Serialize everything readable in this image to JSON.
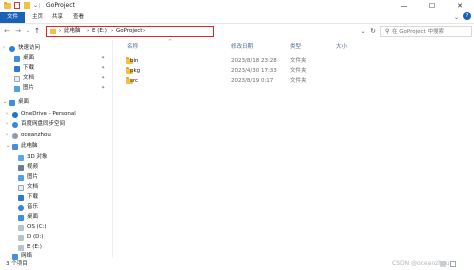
{
  "titlebar": {
    "title": "GoProject",
    "minimize": "—",
    "maximize": "☐",
    "close": "✕"
  },
  "ribbon": {
    "tabs": [
      "文件",
      "主页",
      "共享",
      "查看"
    ]
  },
  "address": {
    "segments": [
      "此电脑",
      "E (E:)",
      "GoProject"
    ],
    "sep": "›"
  },
  "search": {
    "placeholder": "在 GoProject 中搜索"
  },
  "nav": {
    "quick_access": "快速访问",
    "items": [
      {
        "label": "桌面",
        "icon": "desktop-icon",
        "pinned": true
      },
      {
        "label": "下载",
        "icon": "download-icon",
        "pinned": true
      },
      {
        "label": "文档",
        "icon": "document-icon",
        "pinned": true
      },
      {
        "label": "图片",
        "icon": "picture-icon",
        "pinned": true
      }
    ],
    "desktop": "桌面",
    "onedrive": "OneDrive - Personal",
    "baidu": "百度网盘同步空间",
    "user": "oceanzhou",
    "this_pc": "此电脑",
    "pc_items": [
      {
        "label": "3D 对象",
        "icon": "3d-objects-icon"
      },
      {
        "label": "视频",
        "icon": "video-icon"
      },
      {
        "label": "图片",
        "icon": "picture-icon"
      },
      {
        "label": "文档",
        "icon": "document-icon"
      },
      {
        "label": "下载",
        "icon": "download-icon"
      },
      {
        "label": "音乐",
        "icon": "music-icon"
      },
      {
        "label": "桌面",
        "icon": "desktop-icon"
      },
      {
        "label": "OS (C:)",
        "icon": "drive-icon"
      },
      {
        "label": "D (D:)",
        "icon": "drive-icon"
      },
      {
        "label": "E (E:)",
        "icon": "drive-icon"
      },
      {
        "label": "网络",
        "icon": "network-icon"
      }
    ]
  },
  "columns": [
    "名称",
    "修改日期",
    "类型",
    "大小"
  ],
  "files": [
    {
      "name": "bin",
      "date": "2023/8/18 23:28",
      "type": "文件夹"
    },
    {
      "name": "pkg",
      "date": "2023/4/30 17:33",
      "type": "文件夹"
    },
    {
      "name": "src",
      "date": "2023/8/19 0:17",
      "type": "文件夹"
    }
  ],
  "status": "3 个项目",
  "watermark": "CSDN @oceanzhou",
  "colors": {
    "accent": "#1a62b8",
    "address_highlight": "#e0262a",
    "folder": "#f3c043"
  }
}
